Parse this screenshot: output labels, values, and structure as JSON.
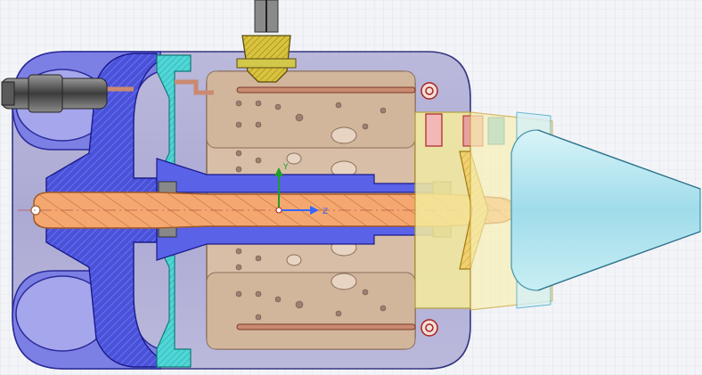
{
  "viewport": {
    "background": "#f3f4f8",
    "grid_color": "#d6dae6"
  },
  "triad": {
    "x_label": "",
    "y_label": "Y",
    "z_label": "Z",
    "y_color": "#1e9e2c",
    "z_color": "#3366ff"
  },
  "model": {
    "colors": {
      "compressor_blue": "#4a52d6",
      "compressor_hatch": "#6a70ff",
      "diffuser_cyan": "#4fd6d6",
      "housing_lavender": "#b9b8d9",
      "combustor_tan": "#d8bea6",
      "combustor_outline": "#8a6f5a",
      "shaft_orange": "#f4a870",
      "shaft_outline": "#a25a28",
      "turbine_yellow": "#f0e070",
      "nozzle_cyan": "#a8e6f0",
      "copper_tube": "#c98a70",
      "fitting_gray": "#707070",
      "fuel_nozzle_yellow": "#d9c23d"
    },
    "parts": [
      "outer-casing",
      "compressor-impeller",
      "diffuser",
      "combustion-chamber",
      "main-shaft",
      "turbine-wheel",
      "exhaust-cone",
      "fuel-fitting",
      "fuel-lines"
    ]
  }
}
